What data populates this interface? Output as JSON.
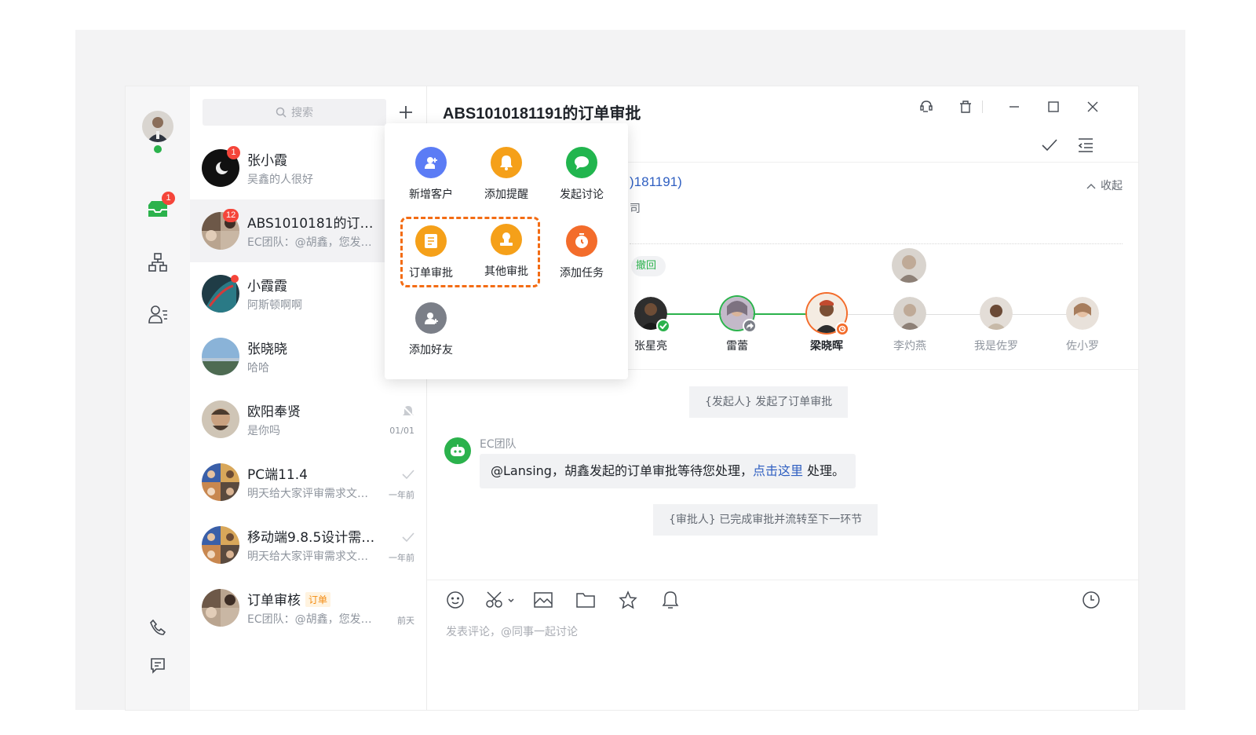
{
  "search": {
    "placeholder": "搜索"
  },
  "rail": {
    "inbox_badge": "1"
  },
  "conversations": [
    {
      "name": "张小霞",
      "preview": "吴鑫的人很好",
      "badge": "1",
      "time": ""
    },
    {
      "name": "ABS1010181的订单…",
      "preview": "EC团队：@胡鑫，您发…",
      "badge": "12",
      "time": ""
    },
    {
      "name": "小霞霞",
      "preview": "阿斯顿啊啊",
      "badge": "",
      "time": ""
    },
    {
      "name": "张晓晓",
      "preview": "哈哈",
      "badge": "",
      "time": ""
    },
    {
      "name": "欧阳奉贤",
      "preview": "是你吗",
      "badge": "",
      "time": "01/01"
    },
    {
      "name": "PC端11.4",
      "preview": "明天给大家评审需求文…",
      "badge": "",
      "time": "一年前"
    },
    {
      "name": "移动端9.8.5设计需…",
      "preview": "明天给大家评审需求文…",
      "badge": "",
      "time": "一年前"
    },
    {
      "name": "订单审核",
      "preview": "EC团队：@胡鑫，您发…",
      "badge": "",
      "time": "前天",
      "tag": "订单"
    }
  ],
  "chat": {
    "title": "ABS1010181191的订单审批",
    "customer_tail": ")181191)",
    "customer_sub": "司",
    "collapse_label": "收起",
    "revoked_label": "撤回",
    "flow": [
      {
        "name": "张星亮",
        "status": "approved"
      },
      {
        "name": "雷蕾",
        "status": "forwarded"
      },
      {
        "name": "梁晓晖",
        "status": "pending"
      },
      {
        "name": "李灼燕",
        "status": "waiting"
      },
      {
        "name": "我是佐罗",
        "status": "waiting"
      },
      {
        "name": "佐小罗",
        "status": "waiting"
      }
    ],
    "system_msg_1": "{发起人} 发起了订单审批",
    "bot_name": "EC团队",
    "bot_msg_prefix": "@Lansing，胡鑫发起的订单审批等待您处理，",
    "bot_msg_link": "点击这里",
    "bot_msg_suffix": " 处理。",
    "system_msg_2": "{审批人} 已完成审批并流转至下一环节",
    "input_placeholder": "发表评论，@同事一起讨论"
  },
  "popup": {
    "items": [
      {
        "label": "新增客户",
        "color": "#5b7cf5",
        "icon": "add-customer-icon"
      },
      {
        "label": "添加提醒",
        "color": "#f5a019",
        "icon": "bell-icon"
      },
      {
        "label": "发起讨论",
        "color": "#21b54e",
        "icon": "chat-bubble-icon"
      },
      {
        "label": "订单审批",
        "color": "#f5a019",
        "icon": "order-list-icon"
      },
      {
        "label": "其他审批",
        "color": "#f5a019",
        "icon": "stamp-icon"
      },
      {
        "label": "添加任务",
        "color": "#f36c2b",
        "icon": "timer-icon"
      },
      {
        "label": "添加好友",
        "color": "#7b7f88",
        "icon": "add-friend-icon"
      }
    ]
  },
  "colors": {
    "accent_green": "#2bb24c",
    "link_blue": "#2f5fc1",
    "highlight_orange": "#f36c14",
    "badge_red": "#f5453a"
  }
}
